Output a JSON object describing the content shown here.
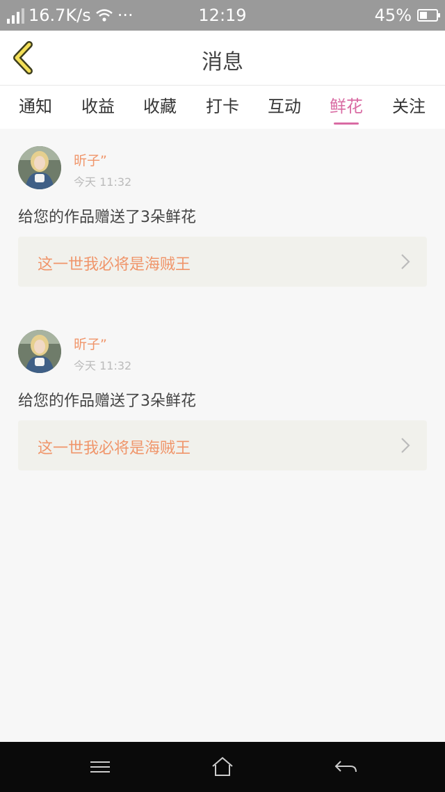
{
  "status_bar": {
    "net_speed": "16.7K/s",
    "dots": "···",
    "time": "12:19",
    "battery": "45%",
    "battery_level": 0.45
  },
  "header": {
    "title": "消息"
  },
  "tabs": [
    {
      "label": "通知",
      "active": false
    },
    {
      "label": "收益",
      "active": false
    },
    {
      "label": "收藏",
      "active": false
    },
    {
      "label": "打卡",
      "active": false
    },
    {
      "label": "互动",
      "active": false
    },
    {
      "label": "鲜花",
      "active": true
    },
    {
      "label": "关注",
      "active": false
    }
  ],
  "messages": [
    {
      "user": "昕子”",
      "time": "今天 11:32",
      "text": "给您的作品赠送了3朵鲜花",
      "work_title": "这一世我必将是海贼王"
    },
    {
      "user": "昕子”",
      "time": "今天 11:32",
      "text": "给您的作品赠送了3朵鲜花",
      "work_title": "这一世我必将是海贼王"
    }
  ],
  "icons": {
    "back": "back-chevron-icon",
    "menu": "menu-icon",
    "home": "home-icon",
    "return": "return-icon",
    "chevron": "chevron-right-icon"
  }
}
